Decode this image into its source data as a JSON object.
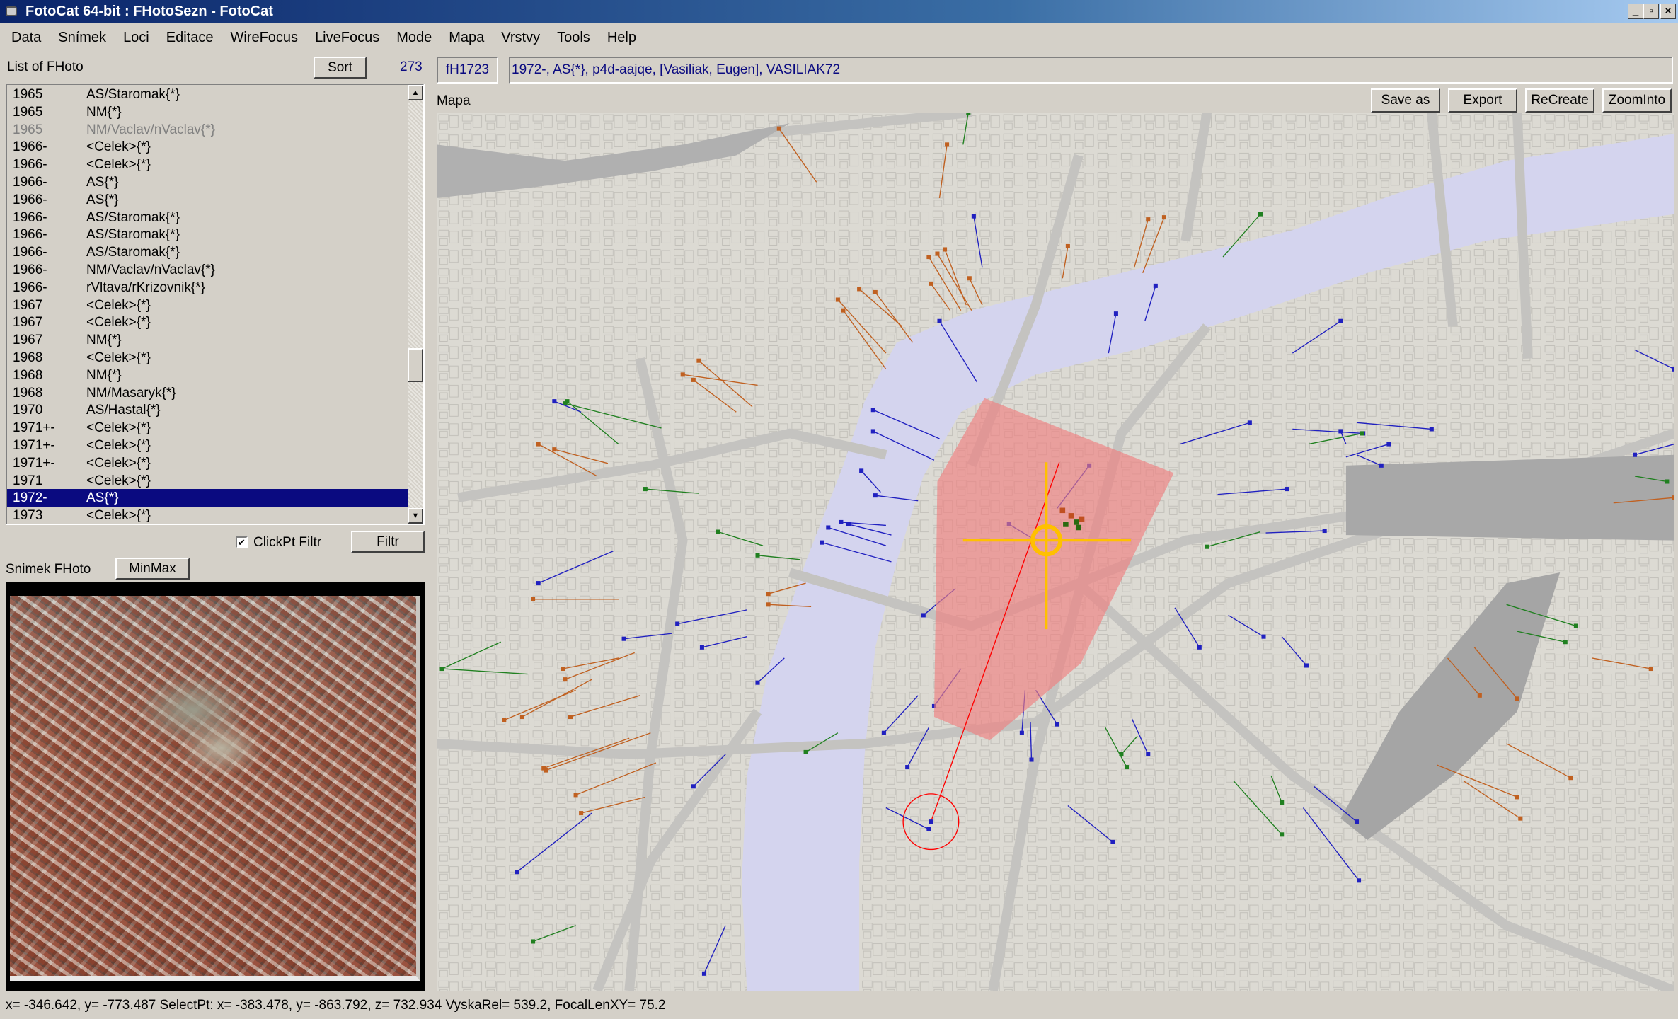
{
  "window": {
    "title": "FotoCat 64-bit : FHotoSezn - FotoCat",
    "controls": [
      "_",
      "▫",
      "×"
    ]
  },
  "menu": [
    "Data",
    "Snímek",
    "Loci",
    "Editace",
    "WireFocus",
    "LiveFocus",
    "Mode",
    "Mapa",
    "Vrstvy",
    "Tools",
    "Help"
  ],
  "list_panel": {
    "label": "List of FHoto",
    "sort_label": "Sort",
    "count": "273",
    "rows": [
      {
        "year": "1965",
        "name": "AS/Staromak{*}"
      },
      {
        "year": "1965",
        "name": "NM{*}"
      },
      {
        "year": "1965",
        "name": "NM/Vaclav/nVaclav{*}",
        "dim": true
      },
      {
        "year": "1966-",
        "name": "<Celek>{*}"
      },
      {
        "year": "1966-",
        "name": "<Celek>{*}"
      },
      {
        "year": "1966-",
        "name": "AS{*}"
      },
      {
        "year": "1966-",
        "name": "AS{*}"
      },
      {
        "year": "1966-",
        "name": "AS/Staromak{*}"
      },
      {
        "year": "1966-",
        "name": "AS/Staromak{*}"
      },
      {
        "year": "1966-",
        "name": "AS/Staromak{*}"
      },
      {
        "year": "1966-",
        "name": "NM/Vaclav/nVaclav{*}"
      },
      {
        "year": "1966-",
        "name": "rVltava/rKrizovnik{*}"
      },
      {
        "year": "1967",
        "name": "<Celek>{*}"
      },
      {
        "year": "1967",
        "name": "<Celek>{*}"
      },
      {
        "year": "1967",
        "name": "NM{*}"
      },
      {
        "year": "1968",
        "name": "<Celek>{*}"
      },
      {
        "year": "1968",
        "name": "NM{*}"
      },
      {
        "year": "1968",
        "name": "NM/Masaryk{*}"
      },
      {
        "year": "1970",
        "name": "AS/Hastal{*}"
      },
      {
        "year": "1971+-",
        "name": "<Celek>{*}"
      },
      {
        "year": "1971+-",
        "name": "<Celek>{*}"
      },
      {
        "year": "1971+-",
        "name": "<Celek>{*}"
      },
      {
        "year": "1971",
        "name": "<Celek>{*}"
      },
      {
        "year": "1972-",
        "name": "AS{*}",
        "selected": true
      },
      {
        "year": "1973",
        "name": "<Celek>{*}"
      }
    ],
    "clickpt_filter_label": "ClickPt Filtr",
    "clickpt_filter_checked": true,
    "filter_label": "Filtr"
  },
  "snimek_panel": {
    "label": "Snimek FHoto",
    "minmax_label": "MinMax"
  },
  "record": {
    "id": "fH1723",
    "description": "1972-, AS{*}, p4d-aajqe, [Vasiliak, Eugen], VASILIAK72"
  },
  "map_panel": {
    "label": "Mapa",
    "buttons": [
      "Save as",
      "Export",
      "ReCreate",
      "ZoomInto"
    ],
    "colors": {
      "river": "#d4d4ee",
      "roads": "#c4c3c0",
      "view_cone": "#f08080",
      "focus": "#ffc000",
      "select_line": "#ff0000"
    }
  },
  "status_bar": "x= -346.642, y= -773.487  SelectPt: x= -383.478, y= -863.792, z= 732.934   VyskaRel= 539.2,   FocalLenXY= 75.2"
}
